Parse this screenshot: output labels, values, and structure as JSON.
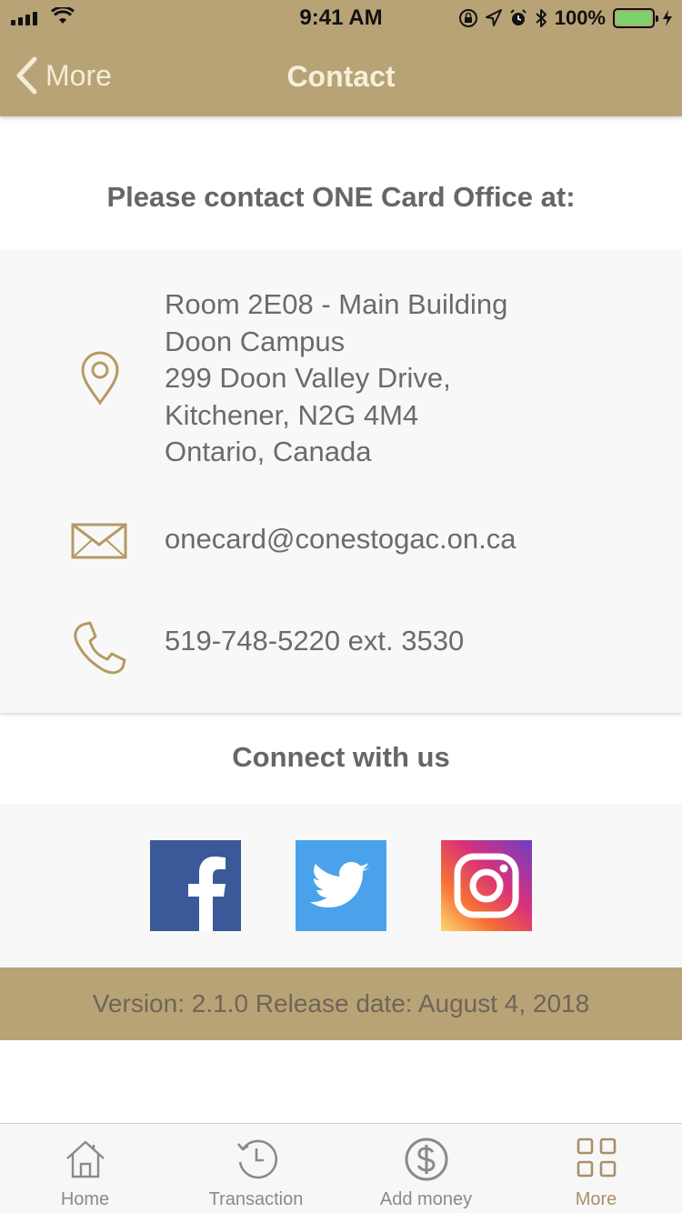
{
  "status_bar": {
    "time": "9:41 AM",
    "battery": "100%",
    "icons": [
      "signal-icon",
      "wifi-icon",
      "orientation-lock-icon",
      "location-icon",
      "alarm-icon",
      "bluetooth-icon",
      "battery-icon",
      "charging-icon"
    ]
  },
  "nav": {
    "back_label": "More",
    "title": "Contact"
  },
  "contact": {
    "heading": "Please contact ONE Card Office at:",
    "address_lines": [
      "Room 2E08 - Main Building",
      "Doon Campus",
      "299 Doon Valley Drive,",
      "Kitchener, N2G 4M4",
      "Ontario, Canada"
    ],
    "email": "onecard@conestogac.on.ca",
    "phone": "519-748-5220 ext. 3530"
  },
  "social": {
    "heading": "Connect with us",
    "items": [
      "facebook-icon",
      "twitter-icon",
      "instagram-icon"
    ]
  },
  "version": "Version: 2.1.0 Release date: August 4, 2018",
  "tabbar": {
    "tabs": [
      {
        "label": "Home",
        "icon": "home-icon"
      },
      {
        "label": "Transaction",
        "icon": "history-icon"
      },
      {
        "label": "Add money",
        "icon": "dollar-icon"
      },
      {
        "label": "More",
        "icon": "grid-icon"
      }
    ],
    "active": "More"
  },
  "colors": {
    "gold": "#b8a377",
    "text_gray": "#6b6b6b",
    "panel_gray": "#f8f8f8",
    "facebook": "#3b5998",
    "twitter": "#4aa3ea"
  }
}
